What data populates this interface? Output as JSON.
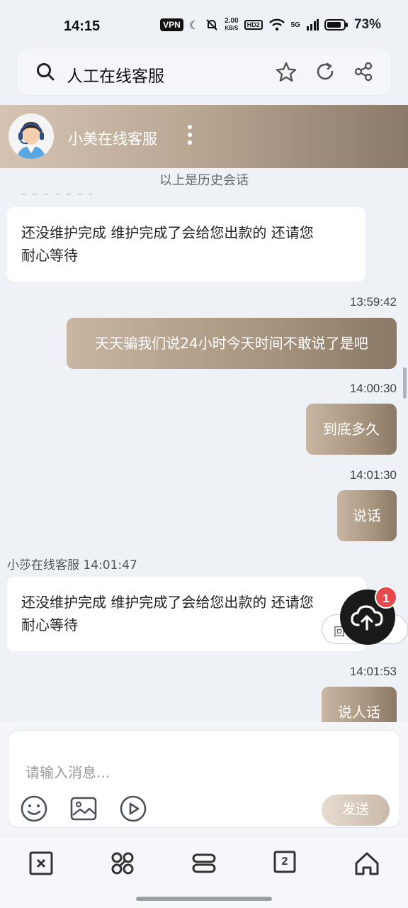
{
  "status_bar": {
    "time": "14:15",
    "vpn": "VPN",
    "net_speed_value": "2.00",
    "net_speed_unit": "KB/S",
    "hd": "HD2",
    "signal": "5G",
    "battery": "73%"
  },
  "search": {
    "query": "人工在线客服"
  },
  "chat_header": {
    "agent_name": "小美在线客服"
  },
  "chat": {
    "history_label": "以上是历史会话",
    "messages": [
      {
        "side": "in",
        "text_line1": "还没维护完成 维护完成了会给您出款的 还请您",
        "text_line2": "耐心等待"
      },
      {
        "side": "out",
        "timestamp": "13:59:42",
        "text": "天天骗我们说24小时今天时间不敢说了是吧"
      },
      {
        "side": "out",
        "timestamp": "14:00:30",
        "text": "到底多久"
      },
      {
        "side": "out",
        "timestamp": "14:01:30",
        "text": "说话"
      },
      {
        "side": "in",
        "sender": "小莎在线客服 14:01:47",
        "text_line1": "还没维护完成 维护完成了会给您出款的 还请您",
        "text_line2": "耐心等待"
      },
      {
        "side": "out",
        "timestamp": "14:01:53",
        "text": "说人话"
      }
    ]
  },
  "floating": {
    "pill_text": "回",
    "badge_count": "1"
  },
  "composer": {
    "placeholder": "请输入消息...",
    "send_label": "发送"
  },
  "bottom_nav": {
    "tabs_count": "2"
  },
  "colors": {
    "accent_gradient_start": "#d5c4b2",
    "accent_gradient_end": "#8b7a68",
    "badge": "#e8474b"
  }
}
